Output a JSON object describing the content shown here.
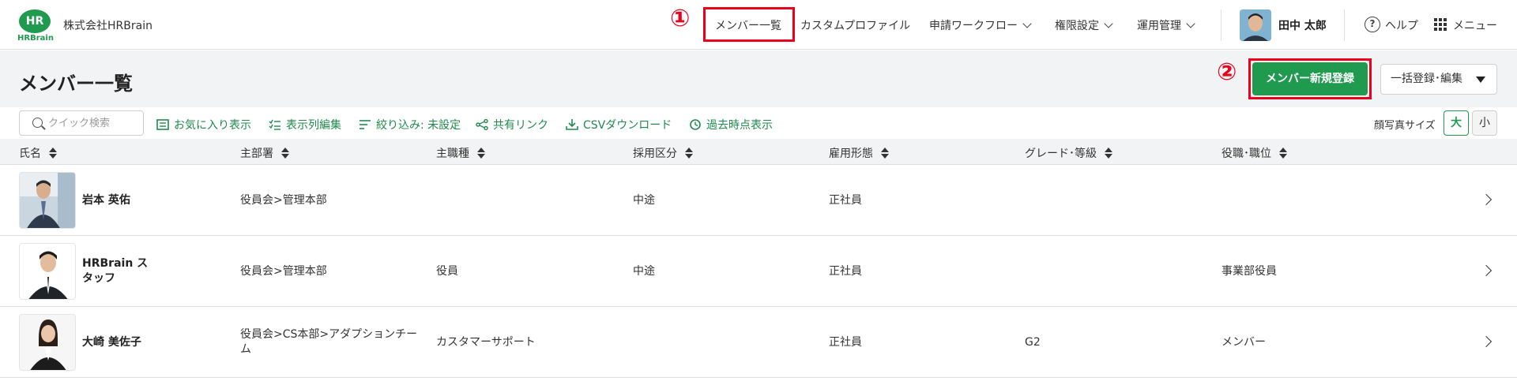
{
  "header": {
    "logo_text": "HR",
    "logo_sub": "HRBrain",
    "company": "株式会社HRBrain",
    "nav": [
      {
        "label": "メンバー一覧",
        "dropdown": false
      },
      {
        "label": "カスタムプロファイル",
        "dropdown": false
      },
      {
        "label": "申請ワークフロー",
        "dropdown": true
      },
      {
        "label": "権限設定",
        "dropdown": true
      },
      {
        "label": "運用管理",
        "dropdown": true
      }
    ],
    "user_name": "田中 太郎",
    "help_label": "ヘルプ",
    "menu_label": "メニュー"
  },
  "annotations": {
    "marker1": "①",
    "marker2": "②",
    "color": "#e8001c"
  },
  "page": {
    "title": "メンバー一覧",
    "new_member_button": "メンバー新規登録",
    "bulk_button": "一括登録･編集"
  },
  "toolbar": {
    "search_placeholder": "クイック検索",
    "favorites": "お気に入り表示",
    "columns": "表示列編集",
    "filter": "絞り込み: 未設定",
    "share": "共有リンク",
    "csv": "CSVダウンロード",
    "history": "過去時点表示",
    "photo_size_label": "顔写真サイズ",
    "size_large": "大",
    "size_small": "小"
  },
  "table": {
    "headers": [
      "氏名",
      "主部署",
      "主職種",
      "採用区分",
      "雇用形態",
      "グレード･等級",
      "役職･職位"
    ],
    "rows": [
      {
        "name": "岩本 英佑",
        "department": "役員会>管理本部",
        "job_type": "",
        "hire_type": "中途",
        "employment": "正社員",
        "grade": "",
        "position": ""
      },
      {
        "name": "HRBrain スタッフ",
        "department": "役員会>管理本部",
        "job_type": "役員",
        "hire_type": "中途",
        "employment": "正社員",
        "grade": "",
        "position": "事業部役員"
      },
      {
        "name": "大崎 美佐子",
        "department": "役員会>CS本部>アダプションチーム",
        "job_type": "カスタマーサポート",
        "hire_type": "",
        "employment": "正社員",
        "grade": "G2",
        "position": "メンバー"
      }
    ]
  },
  "colors": {
    "brand": "#1f9a4f",
    "link": "#1f8a4c",
    "header_bg": "#f2f3f4"
  }
}
